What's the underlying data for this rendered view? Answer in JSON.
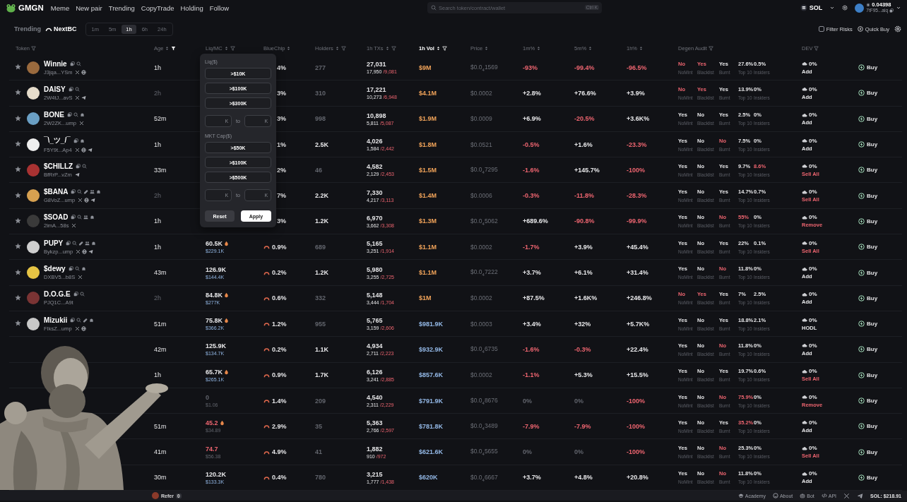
{
  "topbar": {
    "logo": "GMGN",
    "nav": [
      {
        "label": "Meme",
        "selected": false
      },
      {
        "label": "New pair",
        "selected": false
      },
      {
        "label": "Trending",
        "selected": false
      },
      {
        "label": "CopyTrade",
        "selected": false
      },
      {
        "label": "Holding",
        "selected": false
      },
      {
        "label": "Follow",
        "selected": false
      }
    ],
    "search": {
      "placeholder": "Search token/contract/wallet",
      "shortcut": "Ctrl K"
    },
    "chain": "SOL",
    "wallet": {
      "balance": "0.04398",
      "address": "7tF95...aiq"
    }
  },
  "subbar": {
    "tabs": [
      {
        "label": "Trending",
        "selected": false
      },
      {
        "label": "NextBC",
        "selected": true
      }
    ],
    "timeframes": [
      {
        "label": "1m",
        "selected": false
      },
      {
        "label": "5m",
        "selected": false
      },
      {
        "label": "1h",
        "selected": true
      },
      {
        "label": "6h",
        "selected": false
      },
      {
        "label": "24h",
        "selected": false
      }
    ],
    "filter_risks": {
      "label": "Filter Risks",
      "checked": false
    },
    "quick_buy": "Quick Buy"
  },
  "columns": [
    {
      "label": "Token",
      "selected": false,
      "icons": [
        {
          "kind": "filter"
        }
      ]
    },
    {
      "label": "Age",
      "selected": false,
      "icons": [
        {
          "kind": "sort"
        },
        {
          "kind": "filteron"
        }
      ]
    },
    {
      "label": "Liq/MC",
      "selected": false,
      "icons": [
        {
          "kind": "sort"
        },
        {
          "kind": "filter"
        }
      ]
    },
    {
      "label": "BlueChip",
      "selected": false,
      "icons": [
        {
          "kind": "sort"
        }
      ]
    },
    {
      "label": "Holders",
      "selected": false,
      "icons": [
        {
          "kind": "sort"
        },
        {
          "kind": "filter"
        }
      ]
    },
    {
      "label": "1h TXs",
      "selected": false,
      "icons": [
        {
          "kind": "sort"
        },
        {
          "kind": "filter"
        }
      ]
    },
    {
      "label": "1h Vol",
      "selected": true,
      "icons": [
        {
          "kind": "sort"
        },
        {
          "kind": "filter"
        }
      ]
    },
    {
      "label": "Price",
      "selected": false,
      "icons": [
        {
          "kind": "sort"
        }
      ]
    },
    {
      "label": "1m%",
      "selected": false,
      "icons": [
        {
          "kind": "sort"
        }
      ]
    },
    {
      "label": "5m%",
      "selected": false,
      "icons": [
        {
          "kind": "sort"
        }
      ]
    },
    {
      "label": "1h%",
      "selected": false,
      "icons": [
        {
          "kind": "sort"
        }
      ]
    },
    {
      "label": "Degen Audit",
      "selected": false,
      "icons": [
        {
          "kind": "filter"
        }
      ]
    },
    {
      "label": "DEV",
      "selected": false,
      "icons": [
        {
          "kind": "filter"
        }
      ]
    }
  ],
  "rows": [
    {
      "name": "Winnie",
      "badges": [
        {
          "kind": "copy"
        },
        {
          "kind": "search"
        }
      ],
      "addr": "J3jqa...YSm",
      "socials": [
        {
          "kind": "x"
        },
        {
          "kind": "web"
        }
      ],
      "color": "#9a6a3e",
      "age": {
        "text": "1h",
        "kind": "plain"
      },
      "bluechip": {
        "text": "4%"
      },
      "holders": {
        "text": "277",
        "kind": "dim"
      },
      "txs": "27,031",
      "buys": "17,950",
      "sells": "/9,081",
      "vol": {
        "text": "$9M",
        "kind": "warm"
      },
      "price": "$0.0$_{4}$1569",
      "change": [
        {
          "text": "-93%",
          "kind": "alert"
        },
        {
          "text": "-99.4%",
          "kind": "alert"
        },
        {
          "text": "-96.5%",
          "kind": "alert"
        }
      ],
      "audit": [
        {
          "label": "NoMint",
          "value": "No",
          "kind": "alert"
        },
        {
          "label": "Blacklist",
          "value": "Yes",
          "kind": "alert"
        },
        {
          "label": "Burnt",
          "value": "Yes",
          "kind": "plain"
        },
        {
          "label": "Top 10",
          "value": "27.6%",
          "kind": "plain"
        },
        {
          "label": "Insiders",
          "value": "0.5%",
          "kind": "plain"
        }
      ],
      "dev": {
        "share": "0%",
        "action": "Add",
        "kind": "plain"
      },
      "buy": "Buy"
    },
    {
      "name": "DAISY",
      "badges": [
        {
          "kind": "copy"
        },
        {
          "kind": "search"
        }
      ],
      "addr": "2W4tJ...avS",
      "socials": [
        {
          "kind": "x"
        },
        {
          "kind": "tg"
        }
      ],
      "color": "#e6dccb",
      "age": {
        "text": "2h",
        "kind": "dim"
      },
      "bluechip": {
        "text": "3%"
      },
      "holders": {
        "text": "310",
        "kind": "dim"
      },
      "txs": "17,221",
      "buys": "10,273",
      "sells": "/6,948",
      "vol": {
        "text": "$4.1M",
        "kind": "warm"
      },
      "price": "$0.0002",
      "change": [
        {
          "text": "+2.8%",
          "kind": "plain"
        },
        {
          "text": "+76.6%",
          "kind": "plain"
        },
        {
          "text": "+3.9%",
          "kind": "plain"
        }
      ],
      "audit": [
        {
          "label": "NoMint",
          "value": "No",
          "kind": "alert"
        },
        {
          "label": "Blacklist",
          "value": "Yes",
          "kind": "alert"
        },
        {
          "label": "Burnt",
          "value": "Yes",
          "kind": "plain"
        },
        {
          "label": "Top 10",
          "value": "13.9%",
          "kind": "plain"
        },
        {
          "label": "Insiders",
          "value": "0%",
          "kind": "plain"
        }
      ],
      "dev": {
        "share": "0%",
        "action": "Add",
        "kind": "plain"
      },
      "buy": "Buy"
    },
    {
      "name": "BONE",
      "badges": [
        {
          "kind": "copy"
        },
        {
          "kind": "search"
        },
        {
          "kind": "ghost"
        }
      ],
      "addr": "2W2ZK...ump",
      "socials": [
        {
          "kind": "x"
        }
      ],
      "color": "#6a9fc4",
      "age": {
        "text": "52m",
        "kind": "plain"
      },
      "bluechip": {
        "text": "3%"
      },
      "holders": {
        "text": "998",
        "kind": "dim"
      },
      "txs": "10,898",
      "buys": "5,811",
      "sells": "/5,087",
      "vol": {
        "text": "$1.9M",
        "kind": "warm"
      },
      "price": "$0.0009",
      "change": [
        {
          "text": "+6.9%",
          "kind": "plain"
        },
        {
          "text": "-20.5%",
          "kind": "alert"
        },
        {
          "text": "+3.6K%",
          "kind": "plain"
        }
      ],
      "audit": [
        {
          "label": "NoMint",
          "value": "Yes",
          "kind": "plain"
        },
        {
          "label": "Blacklist",
          "value": "No",
          "kind": "plain"
        },
        {
          "label": "Burnt",
          "value": "Yes",
          "kind": "plain"
        },
        {
          "label": "Top 10",
          "value": "2.5%",
          "kind": "plain"
        },
        {
          "label": "Insiders",
          "value": "0%",
          "kind": "plain"
        }
      ],
      "dev": {
        "share": "0%",
        "action": "Add",
        "kind": "plain"
      },
      "buy": "Buy"
    },
    {
      "name": "¯\\_ツ_/¯",
      "badges": [
        {
          "kind": "copy"
        },
        {
          "kind": "ghost"
        }
      ],
      "addr": "F5Y9t...Ap4",
      "socials": [
        {
          "kind": "x"
        },
        {
          "kind": "web"
        },
        {
          "kind": "tg"
        }
      ],
      "color": "#eeeeee",
      "age": {
        "text": "1h",
        "kind": "plain"
      },
      "bluechip": {
        "text": "1%"
      },
      "holders": {
        "text": "2.5K",
        "kind": "plain"
      },
      "txs": "4,026",
      "buys": "1,584",
      "sells": "/2,442",
      "vol": {
        "text": "$1.8M",
        "kind": "warm"
      },
      "price": "$0.0521",
      "change": [
        {
          "text": "-0.5%",
          "kind": "alert"
        },
        {
          "text": "+1.6%",
          "kind": "plain"
        },
        {
          "text": "-23.3%",
          "kind": "alert"
        }
      ],
      "audit": [
        {
          "label": "NoMint",
          "value": "Yes",
          "kind": "plain"
        },
        {
          "label": "Blacklist",
          "value": "No",
          "kind": "plain"
        },
        {
          "label": "Burnt",
          "value": "No",
          "kind": "alert"
        },
        {
          "label": "Top 10",
          "value": "7.5%",
          "kind": "plain"
        },
        {
          "label": "Insiders",
          "value": "0%",
          "kind": "plain"
        }
      ],
      "dev": {
        "share": "0%",
        "action": "Add",
        "kind": "plain"
      },
      "buy": "Buy"
    },
    {
      "name": "$CHILLZ",
      "badges": [
        {
          "kind": "copy"
        },
        {
          "kind": "search"
        }
      ],
      "addr": "BfRrP...vZm",
      "socials": [
        {
          "kind": "tg"
        }
      ],
      "color": "#a83232",
      "age": {
        "text": "33m",
        "kind": "plain"
      },
      "bluechip": {
        "text": "2%"
      },
      "holders": {
        "text": "46",
        "kind": "dim"
      },
      "txs": "4,582",
      "buys": "2,129",
      "sells": "/2,453",
      "vol": {
        "text": "$1.5M",
        "kind": "warm"
      },
      "price": "$0.0$_{4}$7295",
      "change": [
        {
          "text": "-1.6%",
          "kind": "alert"
        },
        {
          "text": "+145.7%",
          "kind": "plain"
        },
        {
          "text": "-100%",
          "kind": "alert"
        }
      ],
      "audit": [
        {
          "label": "NoMint",
          "value": "Yes",
          "kind": "plain"
        },
        {
          "label": "Blacklist",
          "value": "No",
          "kind": "plain"
        },
        {
          "label": "Burnt",
          "value": "Yes",
          "kind": "plain"
        },
        {
          "label": "Top 10",
          "value": "9.7%",
          "kind": "plain"
        },
        {
          "label": "Insiders",
          "value": "8.6%",
          "kind": "alert"
        }
      ],
      "dev": {
        "share": "0%",
        "action": "Sell All",
        "kind": "alert"
      },
      "buy": "Buy"
    },
    {
      "name": "$BANA",
      "badges": [
        {
          "kind": "copy"
        },
        {
          "kind": "search"
        },
        {
          "kind": "pill"
        },
        {
          "kind": "people"
        },
        {
          "kind": "ghost"
        }
      ],
      "addr": "G8VoZ...ump",
      "socials": [
        {
          "kind": "x"
        },
        {
          "kind": "web"
        },
        {
          "kind": "tg"
        }
      ],
      "color": "#d6a050",
      "age": {
        "text": "2h",
        "kind": "dim"
      },
      "bluechip": {
        "text": "7%"
      },
      "holders": {
        "text": "2.2K",
        "kind": "plain"
      },
      "txs": "7,330",
      "buys": "4,217",
      "sells": "/3,113",
      "vol": {
        "text": "$1.4M",
        "kind": "warm"
      },
      "price": "$0.0006",
      "change": [
        {
          "text": "-0.3%",
          "kind": "alert"
        },
        {
          "text": "-11.8%",
          "kind": "alert"
        },
        {
          "text": "-28.3%",
          "kind": "alert"
        }
      ],
      "audit": [
        {
          "label": "NoMint",
          "value": "Yes",
          "kind": "plain"
        },
        {
          "label": "Blacklist",
          "value": "No",
          "kind": "plain"
        },
        {
          "label": "Burnt",
          "value": "Yes",
          "kind": "plain"
        },
        {
          "label": "Top 10",
          "value": "14.7%",
          "kind": "plain"
        },
        {
          "label": "Insiders",
          "value": "0.7%",
          "kind": "plain"
        }
      ],
      "dev": {
        "share": "0%",
        "action": "Sell All",
        "kind": "alert"
      },
      "buy": "Buy"
    },
    {
      "name": "$SOAD",
      "badges": [
        {
          "kind": "copy"
        },
        {
          "kind": "search"
        },
        {
          "kind": "people"
        },
        {
          "kind": "ghost"
        }
      ],
      "addr": "2imA...58s",
      "socials": [
        {
          "kind": "x"
        }
      ],
      "color": "#3a3a3a",
      "age": {
        "text": "1h",
        "kind": "plain"
      },
      "bluechip": {
        "text": "3%"
      },
      "holders": {
        "text": "1.2K",
        "kind": "plain"
      },
      "txs": "6,970",
      "buys": "3,662",
      "sells": "/3,308",
      "vol": {
        "text": "$1.3M",
        "kind": "warm"
      },
      "price": "$0.0$_{4}$5062",
      "change": [
        {
          "text": "+689.6%",
          "kind": "plain"
        },
        {
          "text": "-90.8%",
          "kind": "alert"
        },
        {
          "text": "-99.9%",
          "kind": "alert"
        }
      ],
      "audit": [
        {
          "label": "NoMint",
          "value": "Yes",
          "kind": "plain"
        },
        {
          "label": "Blacklist",
          "value": "No",
          "kind": "plain"
        },
        {
          "label": "Burnt",
          "value": "No",
          "kind": "alert"
        },
        {
          "label": "Top 10",
          "value": "55%",
          "kind": "alert"
        },
        {
          "label": "Insiders",
          "value": "0%",
          "kind": "plain"
        }
      ],
      "dev": {
        "share": "0%",
        "action": "Remove",
        "kind": "alert"
      },
      "buy": "Buy"
    },
    {
      "name": "PUPY",
      "badges": [
        {
          "kind": "copy"
        },
        {
          "kind": "search"
        },
        {
          "kind": "pill"
        },
        {
          "kind": "people"
        },
        {
          "kind": "ghost"
        }
      ],
      "addr": "Bykzp...ump",
      "socials": [
        {
          "kind": "x"
        },
        {
          "kind": "web"
        },
        {
          "kind": "tg"
        }
      ],
      "color": "#cfcfcf",
      "age": {
        "text": "1h",
        "kind": "plain"
      },
      "liq": {
        "text": "60.5K",
        "kind": "plain",
        "icons": [
          {
            "kind": "flame"
          }
        ]
      },
      "mc": {
        "text": "$229.1K",
        "kind": "cool"
      },
      "bluechip": {
        "text": "0.9%",
        "icons": [
          {
            "kind": "gauge"
          }
        ]
      },
      "holders": {
        "text": "689",
        "kind": "dim"
      },
      "txs": "5,165",
      "buys": "3,251",
      "sells": "/1,914",
      "vol": {
        "text": "$1.1M",
        "kind": "warm"
      },
      "price": "$0.0002",
      "change": [
        {
          "text": "-1.7%",
          "kind": "alert"
        },
        {
          "text": "+3.9%",
          "kind": "plain"
        },
        {
          "text": "+45.4%",
          "kind": "plain"
        }
      ],
      "audit": [
        {
          "label": "NoMint",
          "value": "Yes",
          "kind": "plain"
        },
        {
          "label": "Blacklist",
          "value": "No",
          "kind": "plain"
        },
        {
          "label": "Burnt",
          "value": "Yes",
          "kind": "plain"
        },
        {
          "label": "Top 10",
          "value": "22%",
          "kind": "plain"
        },
        {
          "label": "Insiders",
          "value": "0.1%",
          "kind": "plain"
        }
      ],
      "dev": {
        "share": "0%",
        "action": "Sell All",
        "kind": "alert"
      },
      "buy": "Buy"
    },
    {
      "name": "$dewy",
      "badges": [
        {
          "kind": "copy"
        },
        {
          "kind": "search"
        },
        {
          "kind": "ghost"
        }
      ],
      "addr": "DXBV5...b8S",
      "socials": [
        {
          "kind": "x"
        }
      ],
      "color": "#e6c444",
      "age": {
        "text": "43m",
        "kind": "plain"
      },
      "liq": {
        "text": "126.9K",
        "kind": "plain"
      },
      "mc": {
        "text": "$144.4K",
        "kind": "cool"
      },
      "bluechip": {
        "text": "0.2%",
        "icons": [
          {
            "kind": "gauge"
          }
        ]
      },
      "holders": {
        "text": "1.2K",
        "kind": "plain"
      },
      "txs": "5,980",
      "buys": "3,255",
      "sells": "/2,725",
      "vol": {
        "text": "$1.1M",
        "kind": "warm"
      },
      "price": "$0.0$_{4}$7222",
      "change": [
        {
          "text": "+3.7%",
          "kind": "plain"
        },
        {
          "text": "+6.1%",
          "kind": "plain"
        },
        {
          "text": "+31.4%",
          "kind": "plain"
        }
      ],
      "audit": [
        {
          "label": "NoMint",
          "value": "Yes",
          "kind": "plain"
        },
        {
          "label": "Blacklist",
          "value": "No",
          "kind": "plain"
        },
        {
          "label": "Burnt",
          "value": "No",
          "kind": "alert"
        },
        {
          "label": "Top 10",
          "value": "11.8%",
          "kind": "plain"
        },
        {
          "label": "Insiders",
          "value": "0%",
          "kind": "plain"
        }
      ],
      "dev": {
        "share": "0%",
        "action": "Add",
        "kind": "plain"
      },
      "buy": "Buy"
    },
    {
      "name": "D.O.G.E",
      "badges": [
        {
          "kind": "copy"
        },
        {
          "kind": "search"
        }
      ],
      "addr": "PJQ1C...A9t",
      "color": "#7a3434",
      "age": {
        "text": "2h",
        "kind": "dim"
      },
      "liq": {
        "text": "84.8K",
        "kind": "plain",
        "icons": [
          {
            "kind": "flame"
          }
        ]
      },
      "mc": {
        "text": "$277K",
        "kind": "cool"
      },
      "bluechip": {
        "text": "0.6%",
        "icons": [
          {
            "kind": "gauge"
          }
        ]
      },
      "holders": {
        "text": "332",
        "kind": "dim"
      },
      "txs": "5,148",
      "buys": "3,444",
      "sells": "/1,704",
      "vol": {
        "text": "$1M",
        "kind": "warm"
      },
      "price": "$0.0002",
      "change": [
        {
          "text": "+87.5%",
          "kind": "plain"
        },
        {
          "text": "+1.6K%",
          "kind": "plain"
        },
        {
          "text": "+246.8%",
          "kind": "plain"
        }
      ],
      "audit": [
        {
          "label": "NoMint",
          "value": "No",
          "kind": "alert"
        },
        {
          "label": "Blacklist",
          "value": "Yes",
          "kind": "alert"
        },
        {
          "label": "Burnt",
          "value": "Yes",
          "kind": "plain"
        },
        {
          "label": "Top 10",
          "value": "7%",
          "kind": "plain"
        },
        {
          "label": "Insiders",
          "value": "2.5%",
          "kind": "plain"
        }
      ],
      "dev": {
        "share": "0%",
        "action": "Add",
        "kind": "plain"
      },
      "buy": "Buy"
    },
    {
      "name": "Mizukii",
      "badges": [
        {
          "kind": "copy"
        },
        {
          "kind": "search"
        },
        {
          "kind": "pill"
        },
        {
          "kind": "ghost"
        }
      ],
      "addr": "FIksZ...ump",
      "socials": [
        {
          "kind": "x"
        },
        {
          "kind": "web"
        }
      ],
      "color": "#c8c8c8",
      "age": {
        "text": "51m",
        "kind": "plain"
      },
      "liq": {
        "text": "75.8K",
        "kind": "plain",
        "icons": [
          {
            "kind": "flame"
          }
        ]
      },
      "mc": {
        "text": "$366.2K",
        "kind": "cool"
      },
      "bluechip": {
        "text": "1.2%",
        "icons": [
          {
            "kind": "gauge"
          }
        ]
      },
      "holders": {
        "text": "955",
        "kind": "dim"
      },
      "txs": "5,765",
      "buys": "3,159",
      "sells": "/2,606",
      "vol": {
        "text": "$981.9K",
        "kind": "cool"
      },
      "price": "$0.0003",
      "change": [
        {
          "text": "+3.4%",
          "kind": "plain"
        },
        {
          "text": "+32%",
          "kind": "plain"
        },
        {
          "text": "+5.7K%",
          "kind": "plain"
        }
      ],
      "audit": [
        {
          "label": "NoMint",
          "value": "Yes",
          "kind": "plain"
        },
        {
          "label": "Blacklist",
          "value": "No",
          "kind": "plain"
        },
        {
          "label": "Burnt",
          "value": "Yes",
          "kind": "plain"
        },
        {
          "label": "Top 10",
          "value": "18.8%",
          "kind": "plain"
        },
        {
          "label": "Insiders",
          "value": "2.1%",
          "kind": "plain"
        }
      ],
      "dev": {
        "share": "0%",
        "action": "HODL",
        "kind": "plain"
      },
      "buy": "Buy"
    },
    {
      "age": {
        "text": "42m",
        "kind": "plain"
      },
      "liq": {
        "text": "125.9K",
        "kind": "plain"
      },
      "mc": {
        "text": "$134.7K",
        "kind": "cool"
      },
      "bluechip": {
        "text": "0.2%",
        "icons": [
          {
            "kind": "gauge"
          }
        ]
      },
      "holders": {
        "text": "1.1K",
        "kind": "plain"
      },
      "txs": "4,934",
      "buys": "2,711",
      "sells": "/2,223",
      "vol": {
        "text": "$932.9K",
        "kind": "cool"
      },
      "price": "$0.0$_{4}$6735",
      "change": [
        {
          "text": "-1.6%",
          "kind": "alert"
        },
        {
          "text": "-0.3%",
          "kind": "alert"
        },
        {
          "text": "+22.4%",
          "kind": "plain"
        }
      ],
      "audit": [
        {
          "label": "NoMint",
          "value": "Yes",
          "kind": "plain"
        },
        {
          "label": "Blacklist",
          "value": "No",
          "kind": "plain"
        },
        {
          "label": "Burnt",
          "value": "No",
          "kind": "alert"
        },
        {
          "label": "Top 10",
          "value": "11.8%",
          "kind": "plain"
        },
        {
          "label": "Insiders",
          "value": "0%",
          "kind": "plain"
        }
      ],
      "dev": {
        "share": "0%",
        "action": "Add",
        "kind": "plain"
      },
      "buy": "Buy"
    },
    {
      "age": {
        "text": "1h",
        "kind": "plain"
      },
      "liq": {
        "text": "65.7K",
        "kind": "plain",
        "icons": [
          {
            "kind": "flame"
          }
        ]
      },
      "mc": {
        "text": "$265.1K",
        "kind": "cool"
      },
      "bluechip": {
        "text": "0.9%",
        "icons": [
          {
            "kind": "gauge"
          }
        ]
      },
      "holders": {
        "text": "1.7K",
        "kind": "plain"
      },
      "txs": "6,126",
      "buys": "3,241",
      "sells": "/2,885",
      "vol": {
        "text": "$857.6K",
        "kind": "cool"
      },
      "price": "$0.0002",
      "change": [
        {
          "text": "-1.1%",
          "kind": "alert"
        },
        {
          "text": "+5.3%",
          "kind": "plain"
        },
        {
          "text": "+15.5%",
          "kind": "plain"
        }
      ],
      "audit": [
        {
          "label": "NoMint",
          "value": "Yes",
          "kind": "plain"
        },
        {
          "label": "Blacklist",
          "value": "No",
          "kind": "plain"
        },
        {
          "label": "Burnt",
          "value": "Yes",
          "kind": "plain"
        },
        {
          "label": "Top 10",
          "value": "19.7%",
          "kind": "plain"
        },
        {
          "label": "Insiders",
          "value": "0.6%",
          "kind": "plain"
        }
      ],
      "dev": {
        "share": "0%",
        "action": "Sell All",
        "kind": "alert"
      },
      "buy": "Buy"
    },
    {
      "liq": {
        "text": "0",
        "kind": "dim"
      },
      "mc": {
        "text": "$1.06",
        "kind": "dim"
      },
      "bluechip": {
        "text": "1.4%",
        "icons": [
          {
            "kind": "gauge"
          }
        ]
      },
      "holders": {
        "text": "209",
        "kind": "dim"
      },
      "txs": "4,540",
      "buys": "2,311",
      "sells": "/2,229",
      "vol": {
        "text": "$791.9K",
        "kind": "cool"
      },
      "price": "$0.0$_{4}$8676",
      "change": [
        {
          "text": "0%",
          "kind": "dim"
        },
        {
          "text": "0%",
          "kind": "dim"
        },
        {
          "text": "-100%",
          "kind": "alert"
        }
      ],
      "audit": [
        {
          "label": "NoMint",
          "value": "Yes",
          "kind": "plain"
        },
        {
          "label": "Blacklist",
          "value": "No",
          "kind": "plain"
        },
        {
          "label": "Burnt",
          "value": "No",
          "kind": "alert"
        },
        {
          "label": "Top 10",
          "value": "75.9%",
          "kind": "alert"
        },
        {
          "label": "Insiders",
          "value": "0%",
          "kind": "plain"
        }
      ],
      "dev": {
        "share": "0%",
        "action": "Remove",
        "kind": "alert"
      },
      "buy": "Buy"
    },
    {
      "age": {
        "text": "51m",
        "kind": "plain"
      },
      "liq": {
        "text": "45.2",
        "kind": "alert",
        "icons": [
          {
            "kind": "flame"
          }
        ]
      },
      "mc": {
        "text": "$34.89",
        "kind": "dim"
      },
      "bluechip": {
        "text": "2.9%",
        "icons": [
          {
            "kind": "gauge"
          }
        ]
      },
      "holders": {
        "text": "35",
        "kind": "dim"
      },
      "txs": "5,363",
      "buys": "2,766",
      "sells": "/2,597",
      "vol": {
        "text": "$781.8K",
        "kind": "cool"
      },
      "price": "$0.0$_{4}$3489",
      "change": [
        {
          "text": "-7.9%",
          "kind": "alert"
        },
        {
          "text": "-7.9%",
          "kind": "alert"
        },
        {
          "text": "-100%",
          "kind": "alert"
        }
      ],
      "audit": [
        {
          "label": "NoMint",
          "value": "Yes",
          "kind": "plain"
        },
        {
          "label": "Blacklist",
          "value": "No",
          "kind": "plain"
        },
        {
          "label": "Burnt",
          "value": "Yes",
          "kind": "plain"
        },
        {
          "label": "Top 10",
          "value": "35.2%",
          "kind": "alert"
        },
        {
          "label": "Insiders",
          "value": "0%",
          "kind": "plain"
        }
      ],
      "dev": {
        "share": "0%",
        "action": "Add",
        "kind": "plain"
      },
      "buy": "Buy"
    },
    {
      "age": {
        "text": "41m",
        "kind": "plain"
      },
      "liq": {
        "text": "74.7",
        "kind": "alert"
      },
      "mc": {
        "text": "$56.38",
        "kind": "dim"
      },
      "bluechip": {
        "text": "4.9%",
        "icons": [
          {
            "kind": "gauge"
          }
        ]
      },
      "holders": {
        "text": "41",
        "kind": "dim"
      },
      "txs": "1,882",
      "buys": "910",
      "sells": "/972",
      "vol": {
        "text": "$621.6K",
        "kind": "cool"
      },
      "price": "$0.0$_{4}$5655",
      "change": [
        {
          "text": "0%",
          "kind": "dim"
        },
        {
          "text": "0%",
          "kind": "dim"
        },
        {
          "text": "-100%",
          "kind": "alert"
        }
      ],
      "audit": [
        {
          "label": "NoMint",
          "value": "Yes",
          "kind": "plain"
        },
        {
          "label": "Blacklist",
          "value": "No",
          "kind": "plain"
        },
        {
          "label": "Burnt",
          "value": "No",
          "kind": "alert"
        },
        {
          "label": "Top 10",
          "value": "25.3%",
          "kind": "plain"
        },
        {
          "label": "Insiders",
          "value": "0%",
          "kind": "plain"
        }
      ],
      "dev": {
        "share": "0%",
        "action": "Sell All",
        "kind": "alert"
      },
      "buy": "Buy"
    },
    {
      "age": {
        "text": "30m",
        "kind": "plain"
      },
      "liq": {
        "text": "120.2K",
        "kind": "plain"
      },
      "mc": {
        "text": "$133.3K",
        "kind": "cool"
      },
      "bluechip": {
        "text": "0.4%",
        "icons": [
          {
            "kind": "gauge"
          }
        ]
      },
      "holders": {
        "text": "780",
        "kind": "dim"
      },
      "txs": "3,215",
      "buys": "1,777",
      "sells": "/1,438",
      "vol": {
        "text": "$620K",
        "kind": "cool"
      },
      "price": "$0.0$_{4}$6667",
      "change": [
        {
          "text": "+3.7%",
          "kind": "plain"
        },
        {
          "text": "+4.8%",
          "kind": "plain"
        },
        {
          "text": "+20.8%",
          "kind": "plain"
        }
      ],
      "audit": [
        {
          "label": "NoMint",
          "value": "Yes",
          "kind": "plain"
        },
        {
          "label": "Blacklist",
          "value": "No",
          "kind": "plain"
        },
        {
          "label": "Burnt",
          "value": "No",
          "kind": "alert"
        },
        {
          "label": "Top 10",
          "value": "11.8%",
          "kind": "plain"
        },
        {
          "label": "Insiders",
          "value": "0%",
          "kind": "plain"
        }
      ],
      "dev": {
        "share": "0%",
        "action": "Add",
        "kind": "plain"
      },
      "buy": "Buy"
    }
  ],
  "filter_popup": {
    "sections": [
      {
        "title": "Liq($)",
        "options": [
          ">$10K",
          ">$100K",
          ">$300K"
        ],
        "from_unit": "K",
        "between": "to",
        "to_unit": "K"
      },
      {
        "title": "MKT Cap($)",
        "options": [
          ">$50K",
          ">$100K",
          ">$500K"
        ],
        "from_unit": "K",
        "between": "to",
        "to_unit": "K"
      }
    ],
    "reset": "Reset",
    "apply": "Apply"
  },
  "footer": {
    "refer": "Refer",
    "refer_count": "0",
    "links": [
      {
        "label": "Academy",
        "kind": "cap"
      },
      {
        "label": "About",
        "kind": "about"
      },
      {
        "label": "Bot",
        "kind": "bot"
      },
      {
        "label": "API",
        "kind": "code"
      }
    ],
    "sol_price": "SOL: $218.91"
  }
}
